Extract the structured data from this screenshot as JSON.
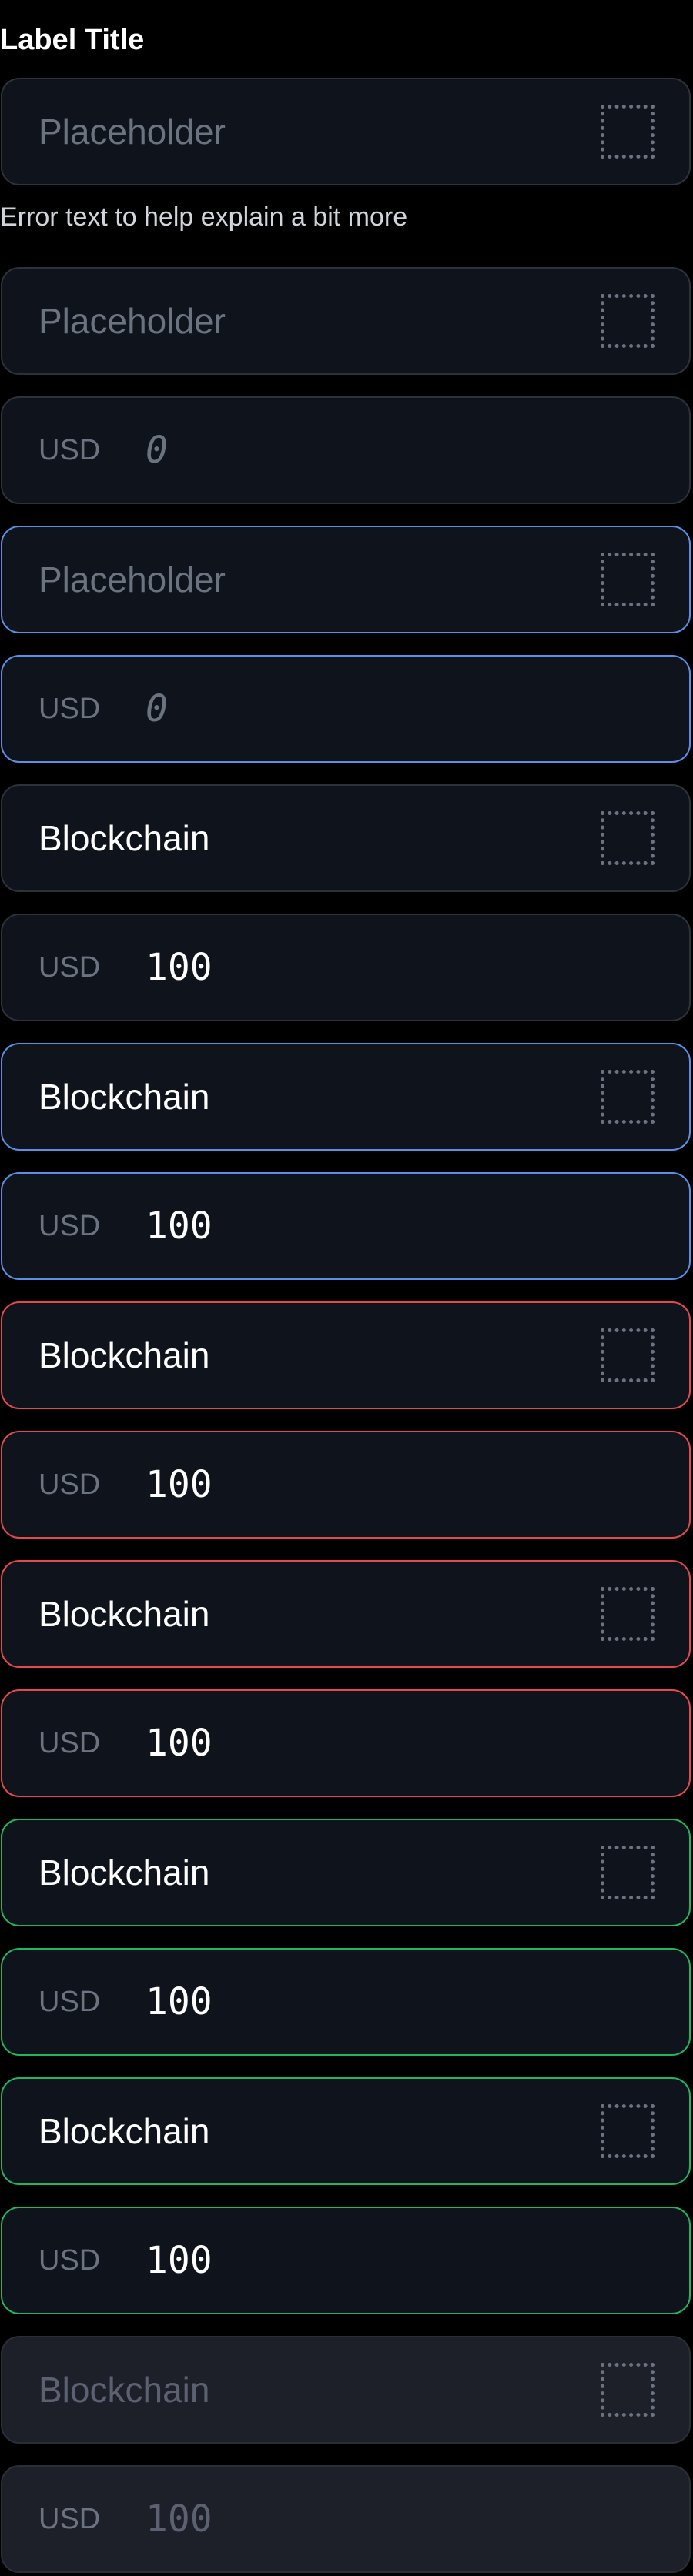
{
  "label_title": "Label Title",
  "helper_text": "Error text to help explain a bit more",
  "colors": {
    "background": "#000000",
    "field_background": "#0f131b",
    "field_disabled_background": "#1d2029",
    "border_default": "#2d3139",
    "border_focus": "#5a8fe6",
    "border_error": "#e5484d",
    "border_success": "#22b45e",
    "placeholder_text": "#6b7280",
    "value_text": "#ffffff"
  },
  "fields": [
    {
      "kind": "text",
      "state": "default",
      "value": "Placeholder",
      "is_placeholder": true,
      "icon": "dotted-square-icon"
    },
    {
      "kind": "text",
      "state": "default",
      "value": "Placeholder",
      "is_placeholder": true,
      "icon": "dotted-square-icon"
    },
    {
      "kind": "currency",
      "state": "default",
      "currency": "USD",
      "value": "0",
      "is_placeholder": true
    },
    {
      "kind": "text",
      "state": "focus",
      "value": "Placeholder",
      "is_placeholder": true,
      "icon": "dotted-square-icon"
    },
    {
      "kind": "currency",
      "state": "focus",
      "currency": "USD",
      "value": "0",
      "is_placeholder": true
    },
    {
      "kind": "text",
      "state": "filled",
      "value": "Blockchain",
      "is_placeholder": false,
      "icon": "dotted-square-icon"
    },
    {
      "kind": "currency",
      "state": "filled",
      "currency": "USD",
      "value": "100",
      "is_placeholder": false
    },
    {
      "kind": "text",
      "state": "focus",
      "value": "Blockchain",
      "is_placeholder": false,
      "icon": "dotted-square-icon"
    },
    {
      "kind": "currency",
      "state": "focus",
      "currency": "USD",
      "value": "100",
      "is_placeholder": false
    },
    {
      "kind": "text",
      "state": "error",
      "value": "Blockchain",
      "is_placeholder": false,
      "icon": "dotted-square-icon"
    },
    {
      "kind": "currency",
      "state": "error",
      "currency": "USD",
      "value": "100",
      "is_placeholder": false
    },
    {
      "kind": "text",
      "state": "error",
      "value": "Blockchain",
      "is_placeholder": false,
      "icon": "dotted-square-icon"
    },
    {
      "kind": "currency",
      "state": "error",
      "currency": "USD",
      "value": "100",
      "is_placeholder": false
    },
    {
      "kind": "text",
      "state": "success",
      "value": "Blockchain",
      "is_placeholder": false,
      "icon": "dotted-square-icon"
    },
    {
      "kind": "currency",
      "state": "success",
      "currency": "USD",
      "value": "100",
      "is_placeholder": false
    },
    {
      "kind": "text",
      "state": "success",
      "value": "Blockchain",
      "is_placeholder": false,
      "icon": "dotted-square-icon"
    },
    {
      "kind": "currency",
      "state": "success",
      "currency": "USD",
      "value": "100",
      "is_placeholder": false
    },
    {
      "kind": "text",
      "state": "disabled",
      "value": "Blockchain",
      "is_placeholder": false,
      "icon": "dotted-square-icon"
    },
    {
      "kind": "currency",
      "state": "disabled",
      "currency": "USD",
      "value": "100",
      "is_placeholder": false
    }
  ]
}
